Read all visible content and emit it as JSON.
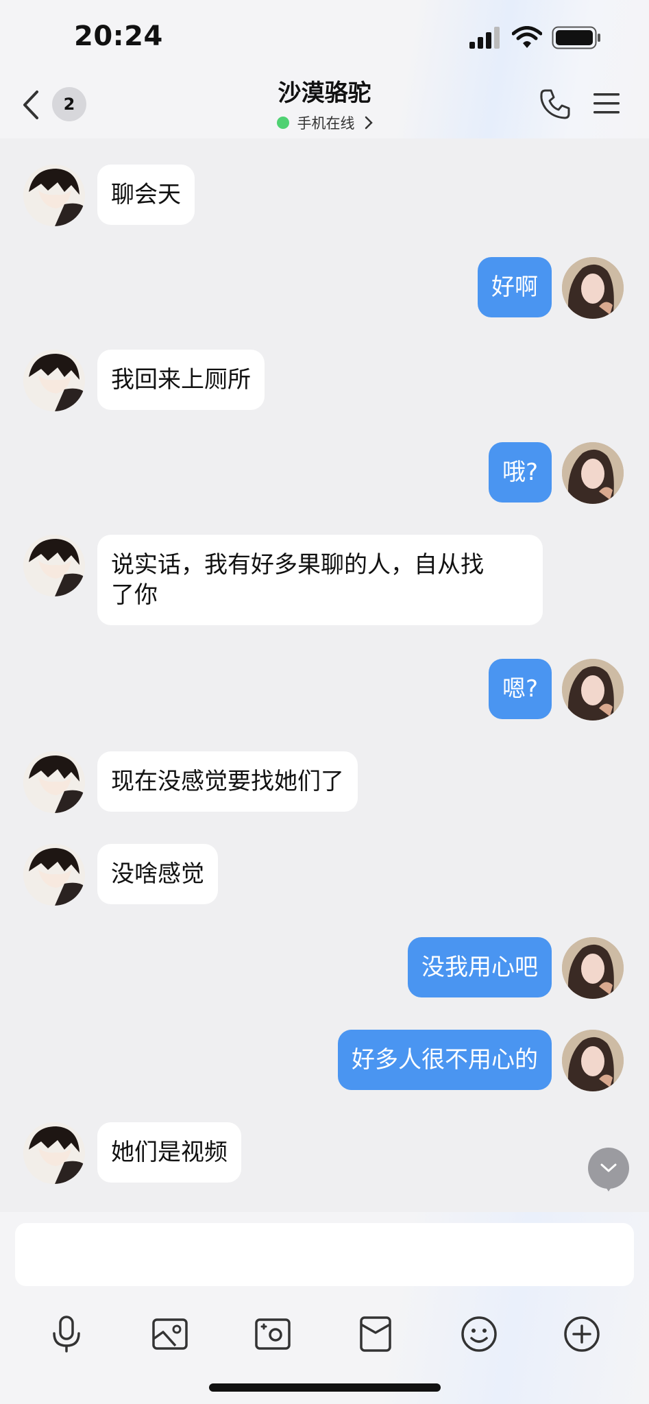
{
  "status_bar": {
    "time": "20:24"
  },
  "header": {
    "unread_count": "2",
    "title": "沙漠骆驼",
    "subtitle": "手机在线"
  },
  "messages": [
    {
      "side": "in",
      "text": "聊会天"
    },
    {
      "side": "out",
      "text": "好啊"
    },
    {
      "side": "in",
      "text": "我回来上厕所"
    },
    {
      "side": "out",
      "text": "哦?"
    },
    {
      "side": "in",
      "text_line1": "说实话，我有好多果聊的人，自从找",
      "text_line2": "了你"
    },
    {
      "side": "out",
      "text": "嗯?"
    },
    {
      "side": "in",
      "text": "现在没感觉要找她们了"
    },
    {
      "side": "in",
      "text": "没啥感觉"
    },
    {
      "side": "out",
      "text": "没我用心吧"
    },
    {
      "side": "out",
      "text": "好多人很不用心的"
    },
    {
      "side": "in",
      "text": "她们是视频"
    }
  ],
  "input": {
    "value": ""
  },
  "toolbar_icons": [
    "microphone-icon",
    "image-icon",
    "camera-icon",
    "red-packet-icon",
    "emoji-icon",
    "plus-icon"
  ],
  "colors": {
    "outgoing_bubble": "#4a95f1",
    "incoming_bubble": "#ffffff",
    "online_dot": "#4fd172"
  }
}
